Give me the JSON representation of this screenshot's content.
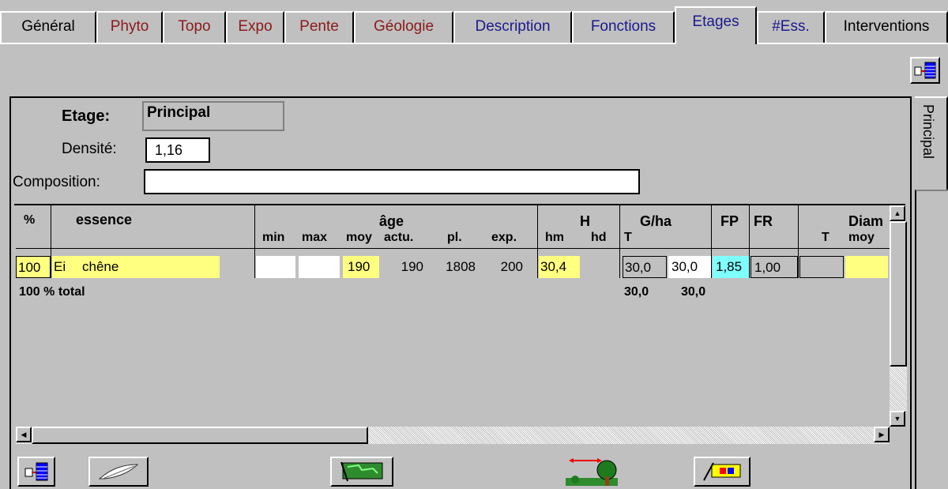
{
  "tabs": [
    {
      "label": "Général",
      "color": "#000000"
    },
    {
      "label": "Phyto",
      "color": "#8b1a1a"
    },
    {
      "label": "Topo",
      "color": "#8b1a1a"
    },
    {
      "label": "Expo",
      "color": "#8b1a1a"
    },
    {
      "label": "Pente",
      "color": "#8b1a1a"
    },
    {
      "label": "Géologie",
      "color": "#8b1a1a"
    },
    {
      "label": "Description",
      "color": "#1a1a8b"
    },
    {
      "label": "Fonctions",
      "color": "#1a1a8b"
    },
    {
      "label": "Etages",
      "color": "#1a1a8b"
    },
    {
      "label": "#Ess.",
      "color": "#1a1a8b"
    },
    {
      "label": "Interventions",
      "color": "#000000"
    }
  ],
  "active_tab": "Etages",
  "form": {
    "etage_label": "Etage:",
    "etage_value": "Principal",
    "densite_label": "Densité:",
    "densite_value": "1,16",
    "composition_label": "Composition:",
    "composition_value": ""
  },
  "side_tab": "Principal",
  "grid": {
    "headers": {
      "pct": "%",
      "essence": "essence",
      "age": "âge",
      "min": "min",
      "max": "max",
      "moy": "moy",
      "actu": "actu.",
      "pl": "pl.",
      "exp": "exp.",
      "h": "H",
      "hm": "hm",
      "hd": "hd",
      "gha": "G/ha",
      "gha_t": "T",
      "fp": "FP",
      "fr": "FR",
      "diam_t": "T",
      "diam": "Diam",
      "diam_moy": "moy"
    },
    "row": {
      "pct": "100",
      "code": "Ei",
      "essence": "chêne",
      "min": "",
      "max": "",
      "moy": "190",
      "actu": "190",
      "pl": "1808",
      "exp": "200",
      "hm": "30,4",
      "hd": "",
      "g_t": "30,0",
      "g_ha": "30,0",
      "fp": "1,85",
      "fr": "1,00",
      "diam_t": "",
      "diam_moy": ""
    },
    "total": {
      "label": "100 % total",
      "g_t": "30,0",
      "g_ha": "30,0"
    }
  },
  "colors": {
    "highlight_yellow": "#ffff80",
    "highlight_cyan": "#80ffff",
    "window_gray": "#c0c0c0"
  },
  "icons": [
    "table-link-icon",
    "feather-icon",
    "flag-map-icon",
    "tree-measure-icon",
    "ruler-pen-icon"
  ]
}
